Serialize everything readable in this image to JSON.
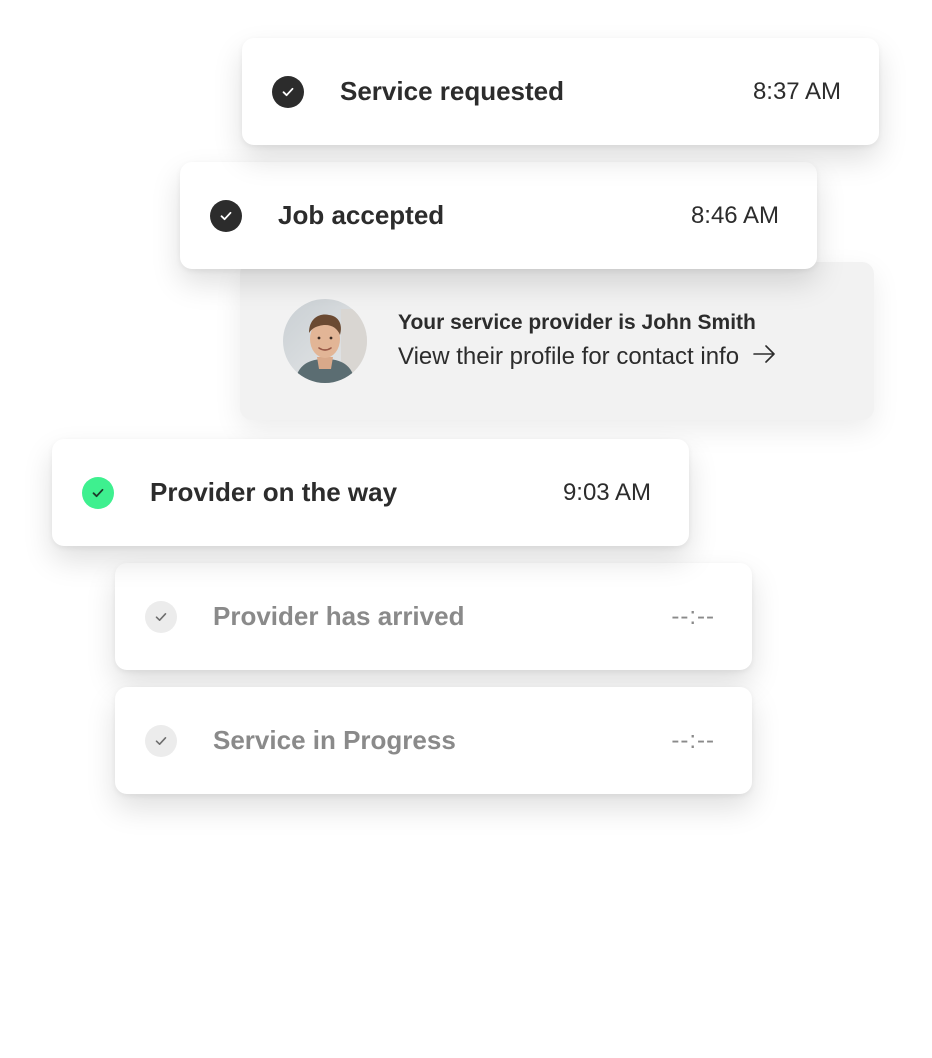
{
  "timeline": [
    {
      "label": "Service requested",
      "time": "8:37 AM",
      "state": "done"
    },
    {
      "label": "Job accepted",
      "time": "8:46 AM",
      "state": "done"
    },
    {
      "label": "Provider on the way",
      "time": "9:03 AM",
      "state": "active"
    },
    {
      "label": "Provider has arrived",
      "time": "--:--",
      "state": "pending"
    },
    {
      "label": "Service in Progress",
      "time": "--:--",
      "state": "pending"
    }
  ],
  "provider": {
    "title": "Your service provider is John Smith",
    "link": "View their profile for contact info",
    "avatar_icon": "person-avatar",
    "arrow_icon": "arrow-right-icon"
  },
  "colors": {
    "done": "#2c2c2c",
    "active": "#3ef08f",
    "pending": "#ececec",
    "pending_text": "#8a8a8a"
  }
}
